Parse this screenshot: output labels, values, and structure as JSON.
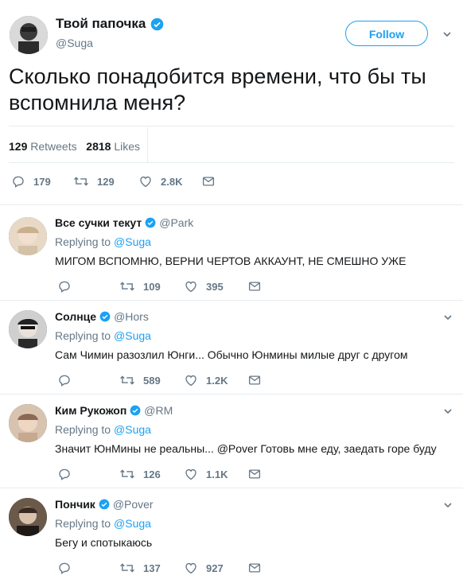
{
  "main_tweet": {
    "display_name": "Твой папочка",
    "handle": "@Suga",
    "follow_label": "Follow",
    "text": "Сколько понадобится времени, что бы ты вспомнила меня?",
    "retweets_count": "129",
    "retweets_label": "Retweets",
    "likes_count": "2818",
    "likes_label": "Likes",
    "actions": {
      "replies": "179",
      "retweets": "129",
      "likes": "2.8K"
    }
  },
  "replies": [
    {
      "display_name": "Все сучки текут",
      "handle": "@Park",
      "replying_prefix": "Replying to",
      "replying_to": "@Suga",
      "text": "МИГОМ ВСПОМНЮ, ВЕРНИ ЧЕРТОВ АККАУНТ, НЕ СМЕШНО УЖЕ",
      "retweets": "109",
      "likes": "395"
    },
    {
      "display_name": "Солнце",
      "handle": "@Hors",
      "replying_prefix": "Replying to",
      "replying_to": "@Suga",
      "text": "Сам Чимин разозлил Юнги... Обычно Юнмины милые друг с другом",
      "retweets": "589",
      "likes": "1.2K"
    },
    {
      "display_name": "Ким Рукожоп",
      "handle": "@RM",
      "replying_prefix": "Replying to",
      "replying_to": "@Suga",
      "text": "Значит ЮнМины не реальны... @Pover Готовь мне еду, заедать горе буду",
      "retweets": "126",
      "likes": "1.1K"
    },
    {
      "display_name": "Пончик",
      "handle": "@Pover",
      "replying_prefix": "Replying to",
      "replying_to": "@Suga",
      "text": "Бегу и спотыкаюсь",
      "retweets": "137",
      "likes": "927"
    }
  ],
  "colors": {
    "accent": "#1da1f2",
    "text": "#14171a",
    "muted": "#657786",
    "divider": "#e6ecf0"
  },
  "icons": [
    "verified-badge-icon",
    "chevron-down-icon",
    "reply-icon",
    "retweet-icon",
    "like-icon",
    "direct-message-icon"
  ]
}
